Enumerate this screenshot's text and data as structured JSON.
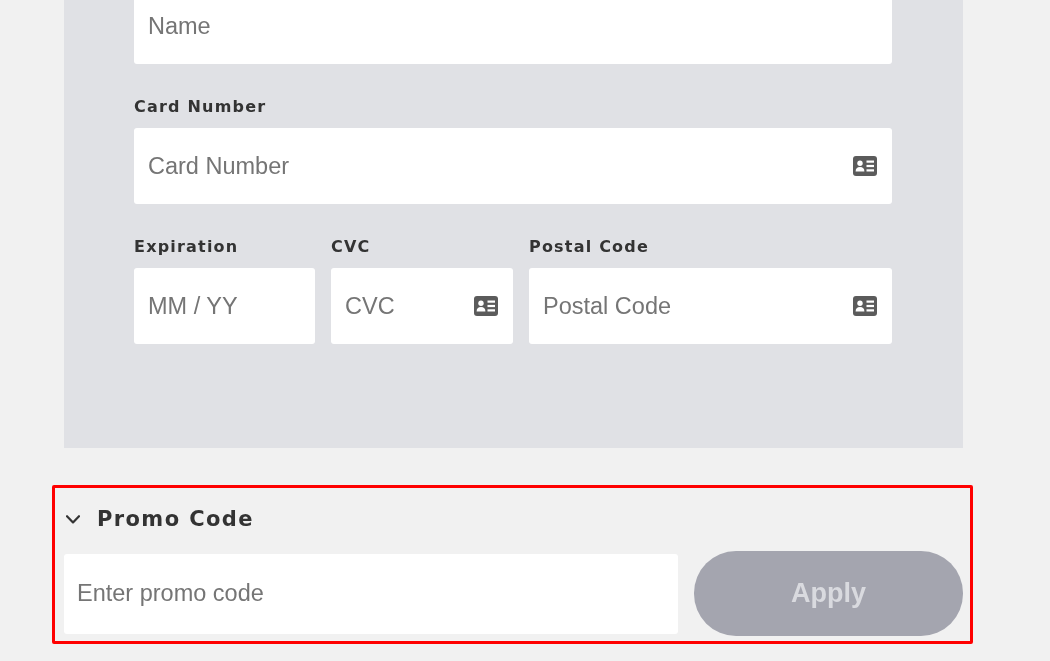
{
  "card_form": {
    "rows": [
      {
        "fields": [
          {
            "placeholder": "Name",
            "card_icon": false
          }
        ]
      },
      {
        "fields": [
          {
            "label": "Card Number",
            "placeholder": "Card Number",
            "card_icon": true
          }
        ]
      },
      {
        "fields": [
          {
            "label": "Expiration",
            "placeholder": "MM / YY",
            "card_icon": false
          },
          {
            "label": "CVC",
            "placeholder": "CVC",
            "card_icon": true
          },
          {
            "label": "Postal Code",
            "placeholder": "Postal Code",
            "card_icon": true
          }
        ]
      }
    ]
  },
  "promo_code": {
    "title": "Promo Code",
    "expanded": true,
    "highlighted": true,
    "input": {
      "placeholder": "Enter promo code"
    },
    "apply_button": {
      "label": "Apply",
      "disabled": true
    }
  }
}
